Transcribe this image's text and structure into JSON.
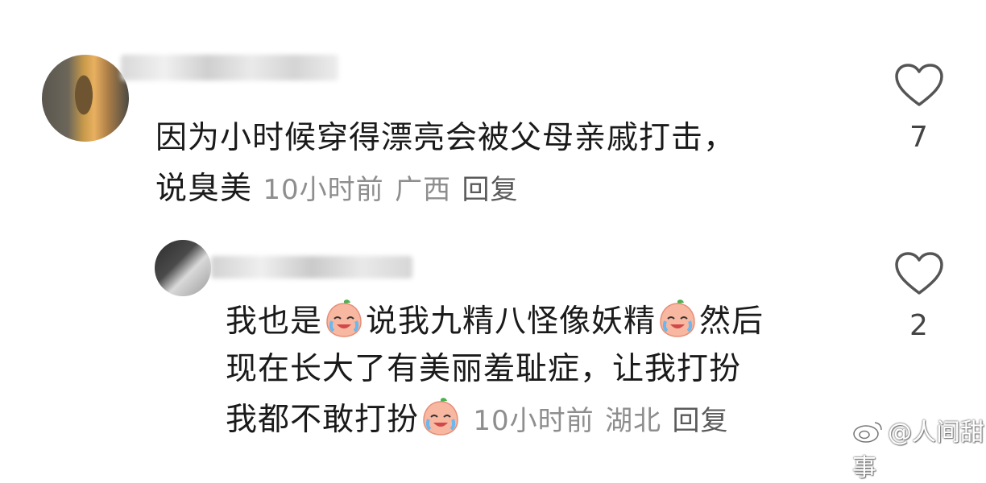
{
  "comments": [
    {
      "line1": "因为小时候穿得漂亮会被父母亲戚打击，",
      "line2_text": "说臭美",
      "time": "10小时前",
      "location": "广西",
      "reply": "回复",
      "likes": "7",
      "icons": {
        "like": "heart-outline-icon"
      }
    },
    {
      "line1_a": "我也是",
      "line1_b": "说我九精八怪像妖精",
      "line1_c": "然后",
      "line2": "现在长大了有美丽羞耻症，让我打扮",
      "line3_text": "我都不敢打扮",
      "time": "10小时前",
      "location": "湖北",
      "reply": "回复",
      "likes": "2",
      "icons": {
        "emoji": "crying-peach-emoji",
        "like": "heart-outline-icon"
      }
    }
  ],
  "watermark": "@人间甜事",
  "colors": {
    "meta": "#8e8e8e",
    "text": "#1a1a1a",
    "heart": "#555555"
  }
}
